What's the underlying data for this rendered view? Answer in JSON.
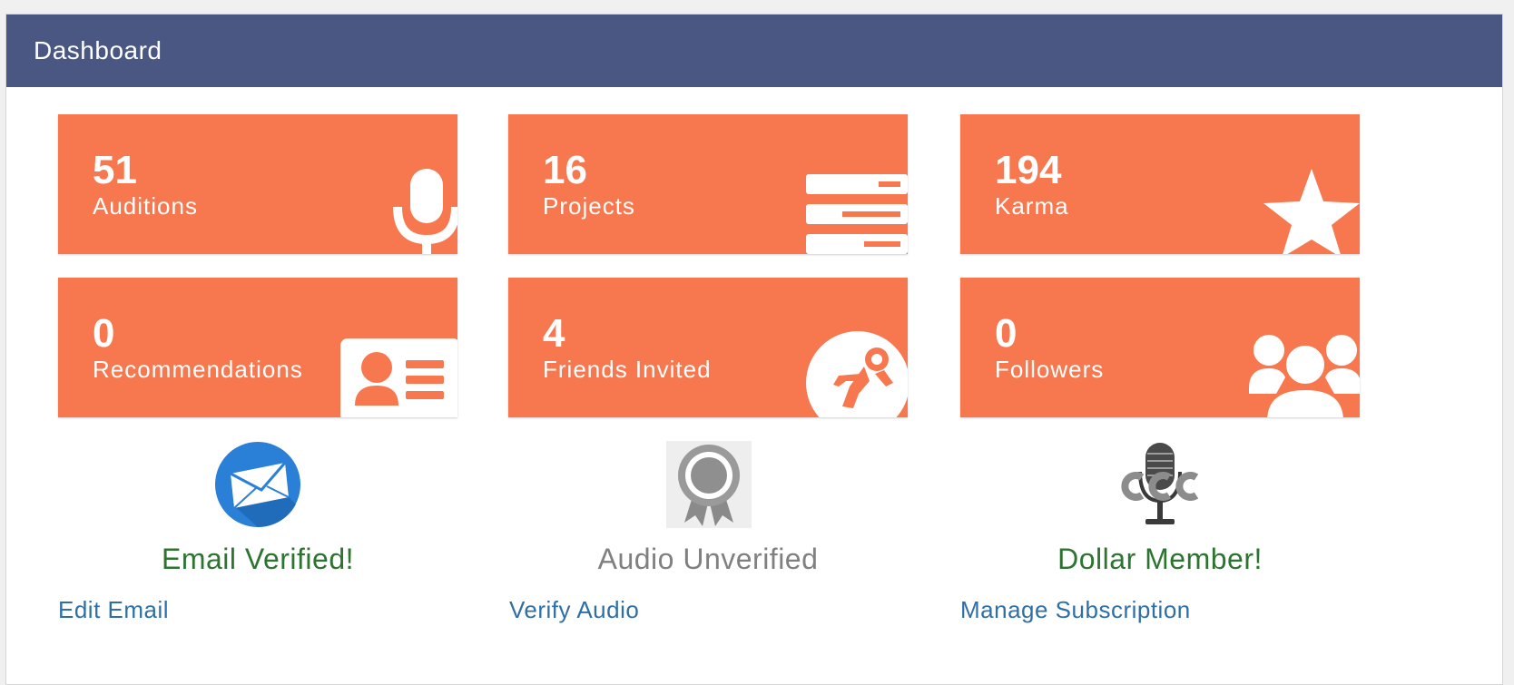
{
  "panel": {
    "title": "Dashboard"
  },
  "stats": [
    {
      "value": "51",
      "label": "Auditions",
      "icon": "microphone-icon"
    },
    {
      "value": "16",
      "label": "Projects",
      "icon": "server-stack-icon"
    },
    {
      "value": "194",
      "label": "Karma",
      "icon": "star-icon"
    },
    {
      "value": "0",
      "label": "Recommendations",
      "icon": "id-card-icon"
    },
    {
      "value": "4",
      "label": "Friends Invited",
      "icon": "astronaut-icon"
    },
    {
      "value": "0",
      "label": "Followers",
      "icon": "users-icon"
    }
  ],
  "badges": [
    {
      "icon": "envelope-icon",
      "status": "Email Verified!",
      "status_color": "#2e7431",
      "link": "Edit Email"
    },
    {
      "icon": "award-ribbon-icon",
      "status": "Audio Unverified",
      "status_color": "#808080",
      "link": "Verify Audio"
    },
    {
      "icon": "mic-logo-icon",
      "status": "Dollar Member!",
      "status_color": "#2e7431",
      "link": "Manage Subscription"
    }
  ],
  "colors": {
    "header": "#4b5783",
    "tile": "#f7784e",
    "link": "#2f6fa7",
    "verified": "#2e7431",
    "unverified": "#808080"
  }
}
